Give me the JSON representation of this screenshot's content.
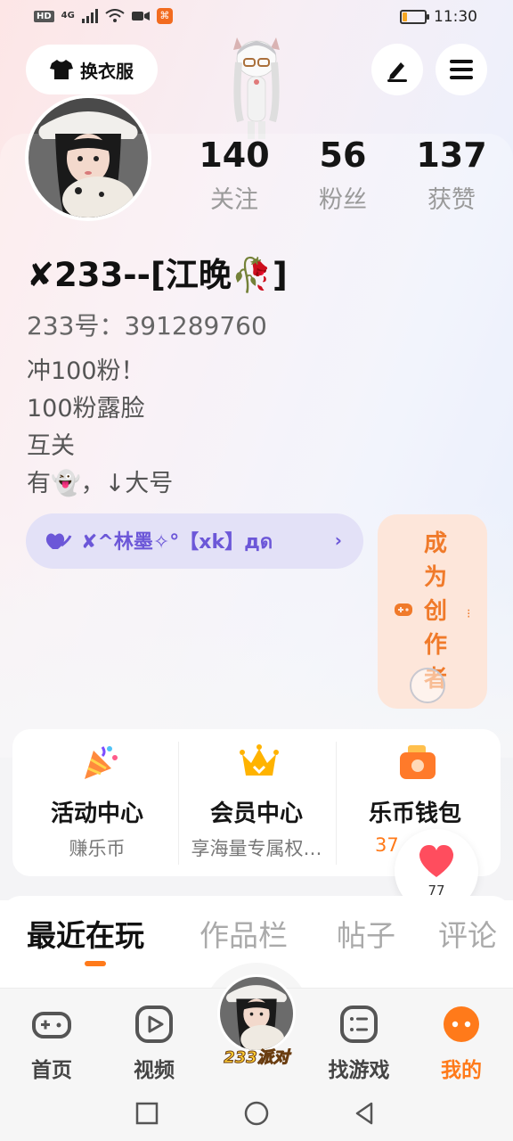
{
  "status_bar": {
    "left_badge": "HD",
    "signal_text": "4G",
    "app_icon_glyph": "⌘",
    "time": "11:30",
    "battery_level": 0.2
  },
  "header": {
    "outfit_label": "换衣服",
    "icons": [
      "shirt-icon",
      "pencil-icon",
      "menu-icon"
    ]
  },
  "profile": {
    "stats": [
      {
        "value": "140",
        "label": "关注"
      },
      {
        "value": "56",
        "label": "粉丝"
      },
      {
        "value": "137",
        "label": "获赞"
      }
    ],
    "username": "✘233--[江晚🥀]",
    "user_id": "233号：391289760",
    "bio": [
      "冲100粉！",
      "100粉露脸",
      "互关",
      "有👻，↓大号"
    ],
    "friend_pill": {
      "text": "✘^林墨✧°【xk】дด",
      "chevron": "›"
    },
    "creator": {
      "text": "成为创作者",
      "dots": "⁝"
    }
  },
  "services": [
    {
      "title": "活动中心",
      "sub": "赚乐币",
      "icon": "party-popper-icon"
    },
    {
      "title": "会员中心",
      "sub": "享海量专属权…",
      "icon": "crown-icon"
    },
    {
      "title": "乐币钱包",
      "sub": "37",
      "icon": "wallet-icon"
    }
  ],
  "like_bubble": {
    "count": "77"
  },
  "tabs": [
    {
      "label": "最近在玩",
      "active": true
    },
    {
      "label": "作品栏",
      "active": false
    },
    {
      "label": "帖子",
      "active": false
    },
    {
      "label": "评论",
      "active": false
    }
  ],
  "bottom_nav": [
    {
      "label": "首页",
      "icon": "gamepad-icon"
    },
    {
      "label": "视频",
      "icon": "play-icon"
    },
    {
      "label": "233派对",
      "icon": "avatar-icon"
    },
    {
      "label": "找游戏",
      "icon": "list-icon"
    },
    {
      "label": "我的",
      "icon": "face-icon"
    }
  ],
  "colors": {
    "accent": "#ff7a1a",
    "purple": "#6c57d8",
    "creator_bg": "#fde6da"
  }
}
